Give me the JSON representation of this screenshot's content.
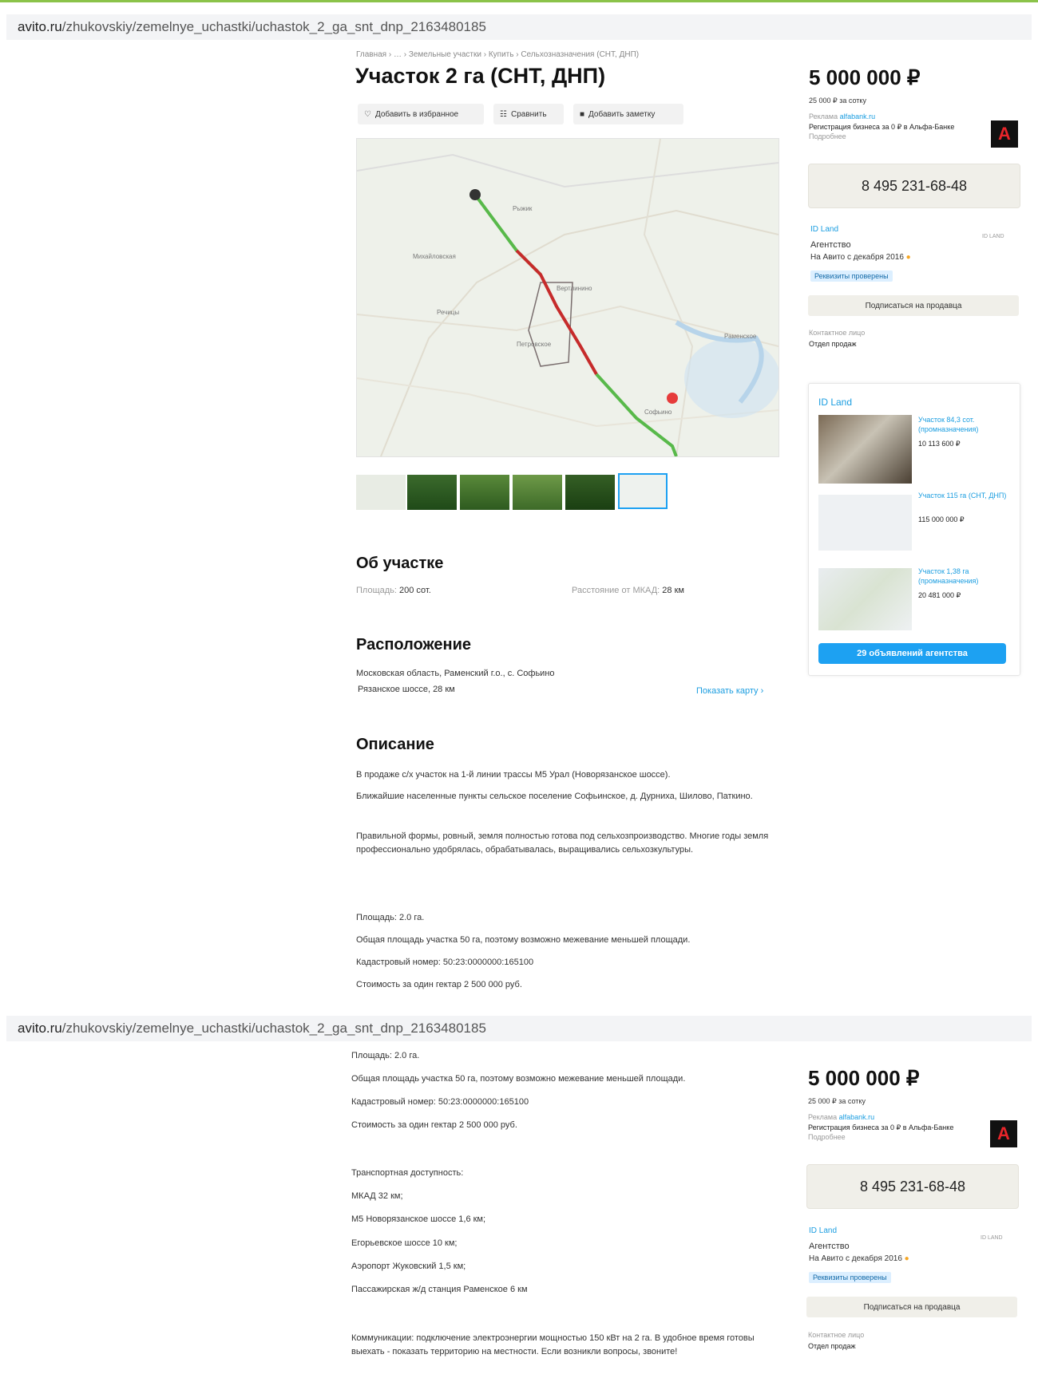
{
  "browser": {
    "url_domain": "avito.ru",
    "url_path": "/zhukovskiy/zemelnye_uchastki/uchastok_2_ga_snt_dnp_2163480185"
  },
  "breadcrumbs": "Главная › … › Земельные участки › Купить › Сельхозназначения (СНТ, ДНП)",
  "title": "Участок 2 га (СНТ, ДНП)",
  "actions": {
    "favorite": "Добавить в избранное",
    "compare": "Сравнить",
    "note": "Добавить заметку"
  },
  "map": {
    "labels": [
      "Рыжик",
      "Михайловская",
      "Вертлинино",
      "Речицы",
      "Петровское",
      "Раменское",
      "Софьино"
    ]
  },
  "about": {
    "heading": "Об участке",
    "area_label": "Площадь:",
    "area_value": "200 сот.",
    "distance_label": "Расстояние от МКАД:",
    "distance_value": "28 км"
  },
  "location": {
    "heading": "Расположение",
    "address": "Московская область, Раменский г.о., с. Софьино",
    "highway": "Рязанское шоссе, 28 км",
    "show_map": "Показать карту ›"
  },
  "description": {
    "heading": "Описание",
    "p1": "В продаже с/х участок на 1-й линии трассы М5 Урал (Новорязанское шоссе).",
    "p2": "Ближайшие населенные пункты сельское поселение Софьинское, д. Дурниха, Шилово, Паткино.",
    "p3": "Правильной формы, ровный, земля полностью готова под сельхозпроизводство. Многие годы земля профессионально удобрялась, обрабатывалась, выращивались сельхозкультуры.",
    "area": "Площадь: 2.0 га.",
    "total_area": "Общая площадь участка 50 га, поэтому возможно межевание меньшей площади.",
    "cadastre": "Кадастровый номер: 50:23:0000000:165100",
    "price_per_ha": "Стоимость за один гектар 2 500 000 руб.",
    "transport_heading": "Транспортная доступность:",
    "transport": [
      "МКАД 32 км;",
      "М5 Новорязанское шоссе 1,6 км;",
      "Егорьевское шоссе 10 км;",
      "Аэропорт Жуковский 1,5 км;",
      "Пассажирская ж/д станция Раменское 6 км"
    ],
    "communications": "Коммуникации: подключение электроэнергии мощностью 150 кВт на 2 га. В удобное время готовы выехать - показать территорию на местности. Если возникли вопросы, звоните!"
  },
  "sidebar": {
    "price": "5 000 000 ₽",
    "price_per_sotka": "25 000 ₽ за сотку",
    "ad_label": "Реклама",
    "ad_domain": "alfabank.ru",
    "ad_text": "Регистрация бизнеса за 0 ₽ в Альфа-Банке",
    "ad_more": "Подробнее",
    "alfa_letter": "А",
    "phone": "8 495 231-68-48",
    "seller_name": "ID Land",
    "seller_type": "Агентство",
    "seller_since": "На Авито с декабря 2016",
    "verified": "Реквизиты проверены",
    "subscribe": "Подписаться на продавца",
    "contact_label": "Контактное лицо",
    "contact_value": "Отдел продаж",
    "logo_text": "ID LAND"
  },
  "agency": {
    "name": "ID Land",
    "items": [
      {
        "title": "Участок 84,3 сот. (промназначения)",
        "price": "10 113 600 ₽"
      },
      {
        "title": "Участок 115 га (СНТ, ДНП)",
        "price": "115 000 000 ₽"
      },
      {
        "title": "Участок 1,38 га (промназначения)",
        "price": "20 481 000 ₽"
      }
    ],
    "all_button": "29 объявлений агентства"
  }
}
